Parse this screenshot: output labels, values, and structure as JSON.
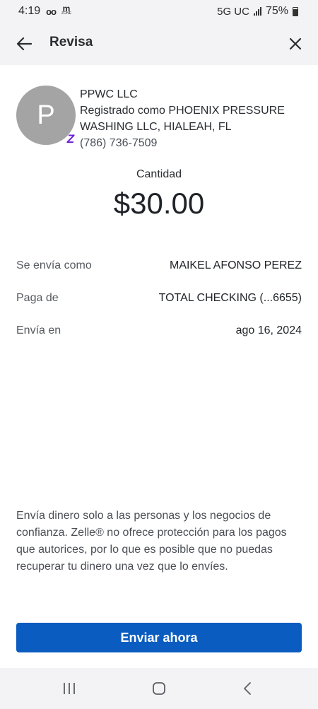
{
  "status_bar": {
    "time": "4:19",
    "network": "5G UC",
    "battery": "75%",
    "icons": [
      "voicemail-icon",
      "mzone-icon",
      "signal-icon",
      "battery-icon"
    ]
  },
  "header": {
    "title": "Revisa",
    "back_icon": "arrow-left-icon",
    "close_icon": "close-icon"
  },
  "recipient": {
    "avatar_initial": "P",
    "name": "PPWC LLC",
    "registration_line1": "Registrado como PHOENIX PRESSURE",
    "registration_line2": "WASHING LLC, HIALEAH, FL",
    "phone": "(786) 736-7509",
    "badge_icon": "zelle-icon",
    "badge_glyph": "Z"
  },
  "amount": {
    "label": "Cantidad",
    "value": "$30.00"
  },
  "details": [
    {
      "label": "Se envía como",
      "value": "MAIKEL AFONSO PEREZ"
    },
    {
      "label": "Paga de",
      "value": "TOTAL CHECKING (...6655)"
    },
    {
      "label": "Envía en",
      "value": "ago 16, 2024"
    }
  ],
  "disclaimer": "Envía dinero solo a las personas y los negocios de confianza. Zelle® no ofrece protección para los pagos que autorices, por lo que es posible que no puedas recuperar tu dinero una vez que lo envíes.",
  "send_button": {
    "label": "Enviar ahora"
  },
  "nav_bar": {
    "buttons": [
      "recent-apps-icon",
      "home-icon",
      "back-icon"
    ]
  },
  "colors": {
    "accent": "#0b5cc0",
    "zelle": "#6d1ed4",
    "avatar_bg": "#a4a4a4",
    "header_bg": "#f3f3f5"
  }
}
